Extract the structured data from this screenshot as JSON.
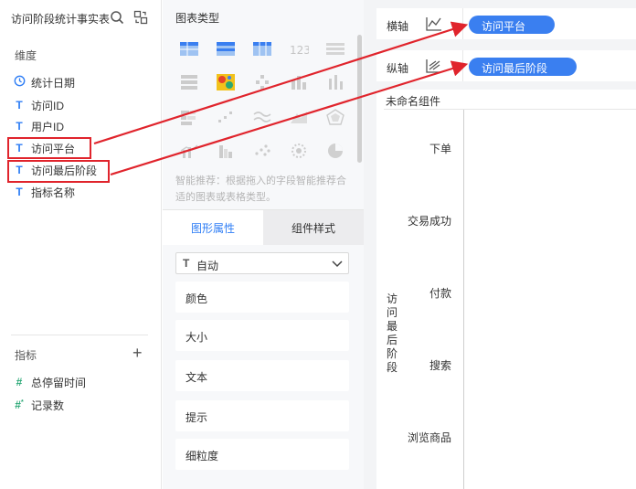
{
  "left_panel": {
    "title": "访问阶段统计事实表",
    "dimensions_label": "维度",
    "dimensions": [
      {
        "label": "统计日期",
        "type": "date"
      },
      {
        "label": "访问ID",
        "type": "text"
      },
      {
        "label": "用户ID",
        "type": "text"
      },
      {
        "label": "访问平台",
        "type": "text"
      },
      {
        "label": "访问最后阶段",
        "type": "text"
      },
      {
        "label": "指标名称",
        "type": "text"
      }
    ],
    "metrics_label": "指标",
    "metrics": [
      {
        "label": "总停留时间",
        "type": "number"
      },
      {
        "label": "记录数",
        "type": "number-computed"
      }
    ]
  },
  "middle_panel": {
    "title": "图表类型",
    "hint": "智能推荐：根据拖入的字段智能推荐合适的图表或表格类型。",
    "tabs": [
      {
        "label": "图形属性",
        "active": true
      },
      {
        "label": "组件样式",
        "active": false
      }
    ],
    "select_value": "自动",
    "properties": [
      "颜色",
      "大小",
      "文本",
      "提示",
      "细粒度"
    ]
  },
  "right_panel": {
    "x_axis": {
      "label": "横轴",
      "field": "访问平台"
    },
    "y_axis": {
      "label": "纵轴",
      "field": "访问最后阶段"
    },
    "widget_title": "未命名组件",
    "y_label": "访问最后阶段",
    "categories": [
      "下单",
      "交易成功",
      "付款",
      "搜索",
      "浏览商品"
    ]
  },
  "colors": {
    "accent": "#2f7ef5",
    "pill": "#3a7ff0",
    "highlight": "#e0242c"
  }
}
